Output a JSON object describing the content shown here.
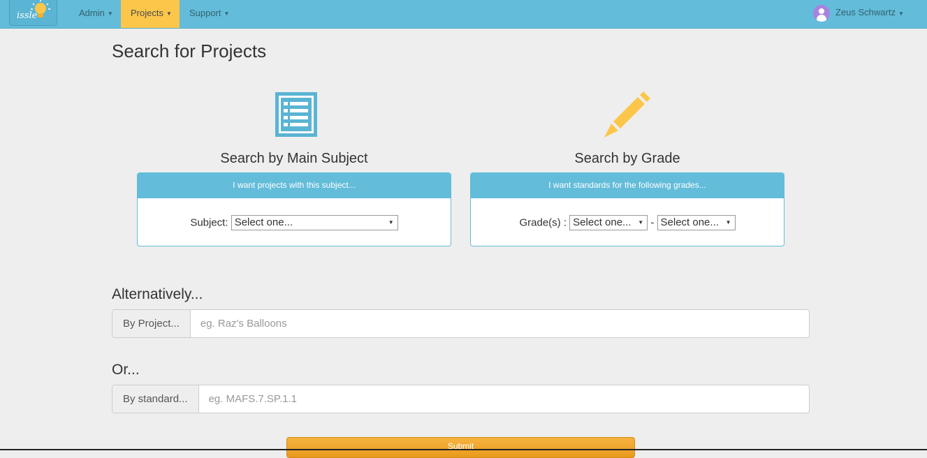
{
  "navbar": {
    "logo_text": "issle",
    "items": [
      {
        "label": "Admin",
        "active": false
      },
      {
        "label": "Projects",
        "active": true
      },
      {
        "label": "Support",
        "active": false
      }
    ],
    "user_name": "Zeus Schwartz",
    "accent_color": "#63bcd9",
    "active_color": "#fcc64b"
  },
  "page_title": "Search for Projects",
  "subject_search": {
    "icon": "list-icon",
    "heading": "Search by Main Subject",
    "panel_heading": "I want projects with this subject...",
    "label": "Subject:",
    "select_value": "Select one..."
  },
  "grade_search": {
    "icon": "pencil-icon",
    "heading": "Search by Grade",
    "panel_heading": "I want standards for the following grades...",
    "label": "Grade(s) :",
    "from_value": "Select one...",
    "separator": "-",
    "to_value": "Select one..."
  },
  "alternative": {
    "heading": "Alternatively...",
    "addon": "By Project...",
    "placeholder": "eg. Raz's Balloons"
  },
  "or_section": {
    "heading": "Or...",
    "addon": "By standard...",
    "placeholder": "eg. MAFS.7.SP.1.1"
  },
  "submit_label": "Submit",
  "submit_color": "#f0a430"
}
